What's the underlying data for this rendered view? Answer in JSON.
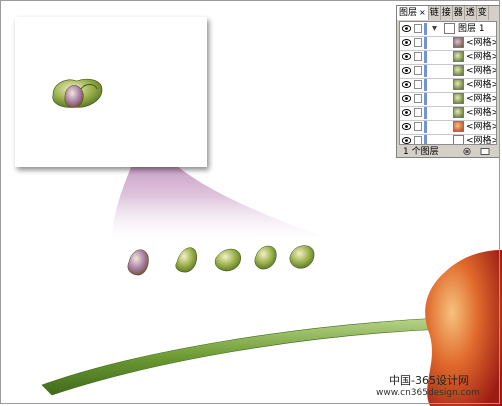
{
  "panel": {
    "tabs": [
      "图层",
      "链",
      "接",
      "器",
      "透",
      "变"
    ],
    "layer_name": "图层 1",
    "sublayers": [
      "<网格>",
      "<网格>",
      "<网格>",
      "<网格>",
      "<网格>",
      "<网格>",
      "<网格>"
    ],
    "layer_count": "1 个图层"
  },
  "watermark": {
    "line1": "中国-365设计网",
    "line2": "www.cn365design.com"
  },
  "colors": {
    "arrow": "#8e3d89",
    "stem": "#5f8a2c",
    "highlight": "#6f94d8"
  }
}
